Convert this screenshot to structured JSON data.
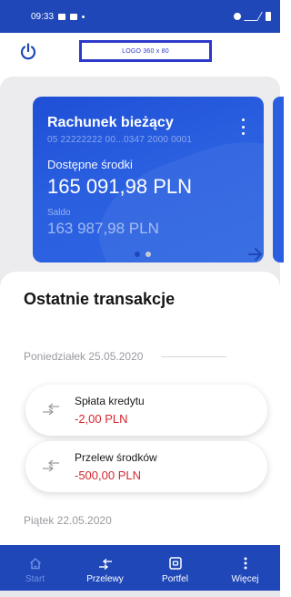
{
  "statusbar": {
    "time": "09:33"
  },
  "header": {
    "logo_text": "LOGO 360 x 80"
  },
  "account_card": {
    "title": "Rachunek bieżący",
    "account_number": "05 22222222 00...0347 2000 0001",
    "available_label": "Dostępne środki",
    "available_amount": "165 091,98 PLN",
    "balance_label": "Saldo",
    "balance_amount": "163 987,98 PLN"
  },
  "pager": {
    "count": 2,
    "active_index": 0
  },
  "transactions": {
    "title": "Ostatnie transakcje",
    "groups": [
      {
        "date": "Poniedziałek 25.05.2020",
        "items": [
          {
            "name": "Spłata kredytu",
            "amount": "-2,00 PLN"
          },
          {
            "name": "Przelew środków",
            "amount": "-500,00 PLN"
          }
        ]
      },
      {
        "date": "Piątek 22.05.2020",
        "items": []
      }
    ]
  },
  "bottom_nav": [
    {
      "label": "Start",
      "icon": "home-icon",
      "active": true
    },
    {
      "label": "Przelewy",
      "icon": "transfer-icon",
      "active": false
    },
    {
      "label": "Portfel",
      "icon": "wallet-icon",
      "active": false
    },
    {
      "label": "Więcej",
      "icon": "more-icon",
      "active": false
    }
  ],
  "colors": {
    "primary": "#1f47b8",
    "card": "#2a5fe0",
    "negative": "#d7262e"
  }
}
